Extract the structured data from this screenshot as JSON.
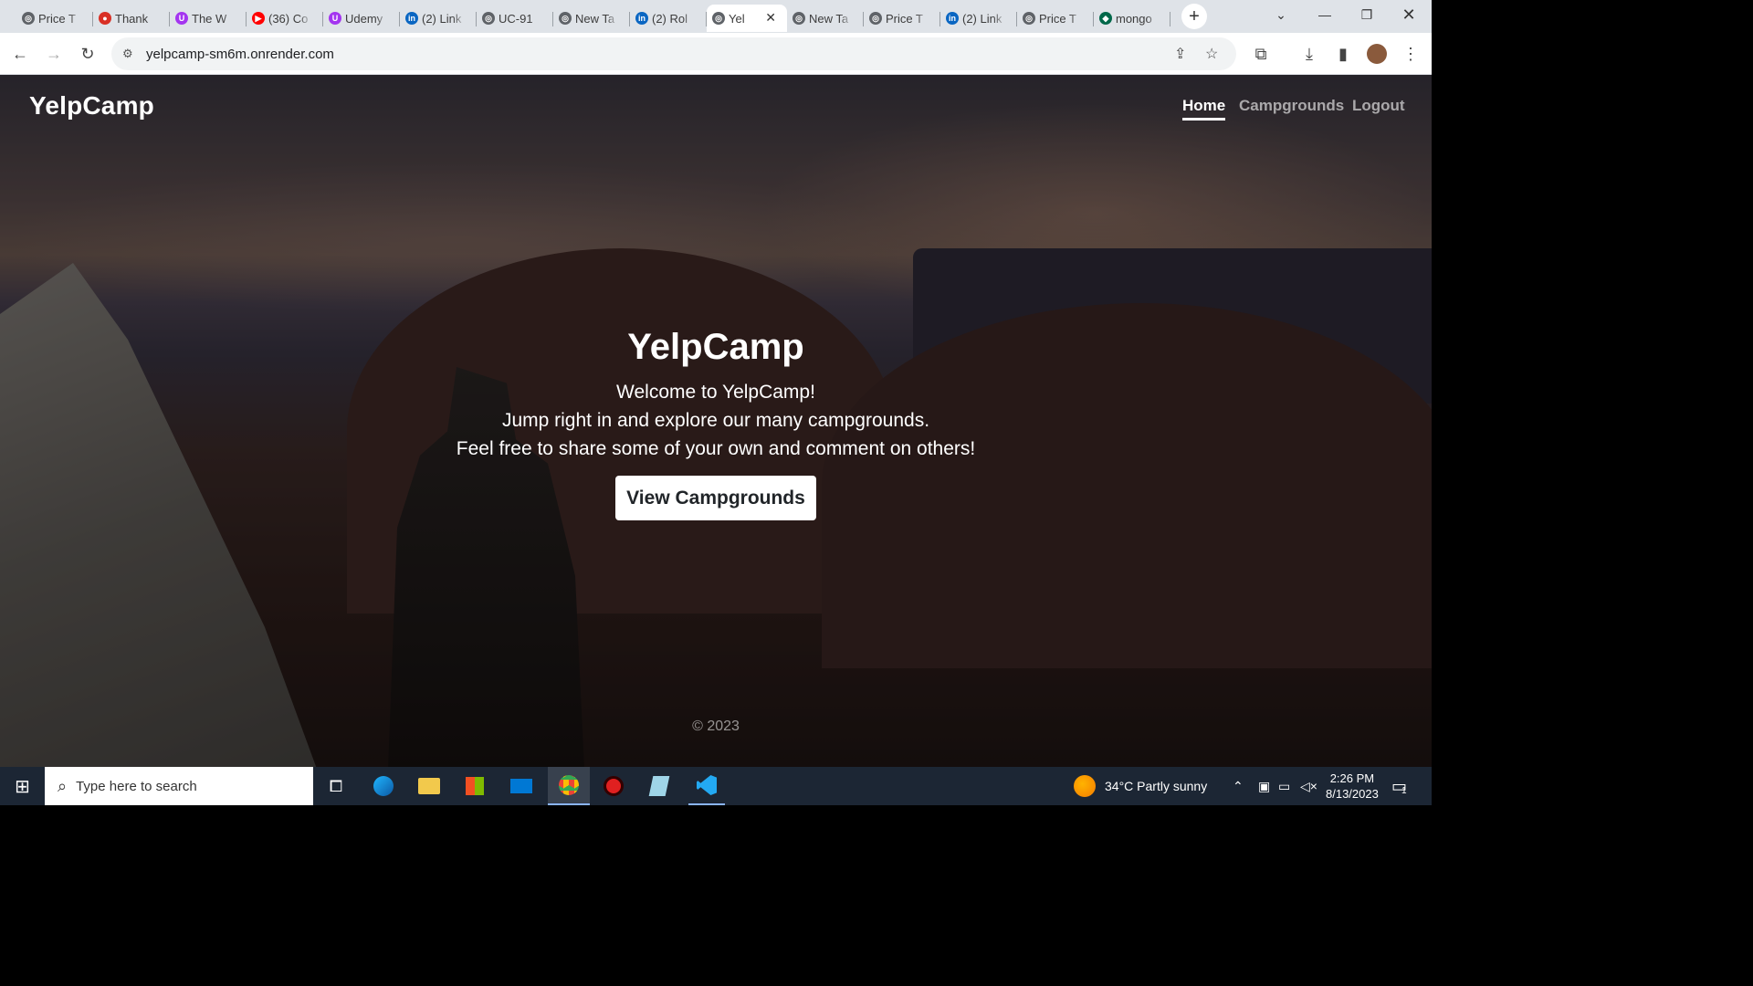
{
  "browser": {
    "tabs": [
      {
        "label": "Price T",
        "icon": "globe-icon",
        "color": "#5f6368"
      },
      {
        "label": "Thank",
        "icon": "record-icon",
        "color": "#d93025"
      },
      {
        "label": "The W",
        "icon": "udemy-icon",
        "color": "#a435f0"
      },
      {
        "label": "(36) Co",
        "icon": "youtube-icon",
        "color": "#ff0000"
      },
      {
        "label": "Udemy",
        "icon": "udemy-icon",
        "color": "#a435f0"
      },
      {
        "label": "(2) Link",
        "icon": "linkedin-icon",
        "color": "#0a66c2"
      },
      {
        "label": "UC-91",
        "icon": "globe-icon",
        "color": "#5f6368"
      },
      {
        "label": "New Ta",
        "icon": "globe-icon",
        "color": "#5f6368"
      },
      {
        "label": "(2) Rol",
        "icon": "linkedin-icon",
        "color": "#0a66c2"
      },
      {
        "label": "Yel",
        "icon": "globe-icon",
        "color": "#5f6368",
        "active": true
      },
      {
        "label": "New Ta",
        "icon": "globe-icon",
        "color": "#5f6368"
      },
      {
        "label": "Price T",
        "icon": "globe-icon",
        "color": "#5f6368"
      },
      {
        "label": "(2) Link",
        "icon": "linkedin-icon",
        "color": "#0a66c2"
      },
      {
        "label": "Price T",
        "icon": "globe-icon",
        "color": "#5f6368"
      },
      {
        "label": "mongo",
        "icon": "mongodb-icon",
        "color": "#00684a"
      }
    ],
    "url": "yelpcamp-sm6m.onrender.com"
  },
  "page": {
    "brand": "YelpCamp",
    "nav": {
      "home": "Home",
      "campgrounds": "Campgrounds",
      "logout": "Logout"
    },
    "hero": {
      "title": "YelpCamp",
      "line1": "Welcome to YelpCamp!",
      "line2": "Jump right in and explore our many campgrounds.",
      "line3": "Feel free to share some of your own and comment on others!",
      "button": "View Campgrounds"
    },
    "footer": "© 2023"
  },
  "taskbar": {
    "search_placeholder": "Type here to search",
    "weather": "34°C  Partly sunny",
    "time": "2:26 PM",
    "date": "8/13/2023",
    "notifications": "1"
  }
}
